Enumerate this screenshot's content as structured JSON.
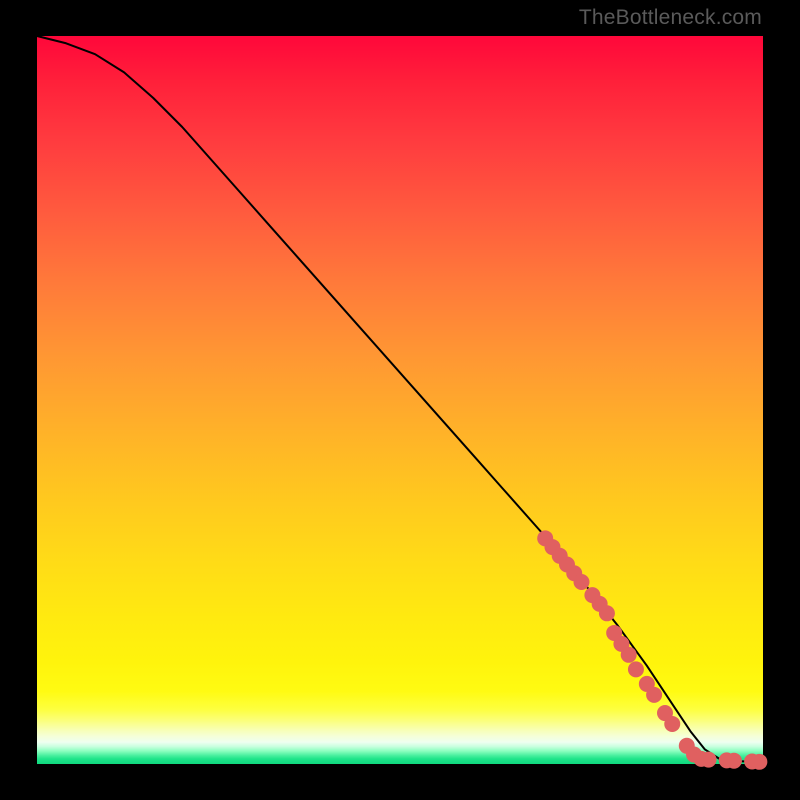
{
  "watermark": "TheBottleneck.com",
  "chart_data": {
    "type": "line",
    "title": "",
    "xlabel": "",
    "ylabel": "",
    "xlim": [
      0,
      100
    ],
    "ylim": [
      0,
      100
    ],
    "grid": false,
    "legend": false,
    "series": [
      {
        "name": "curve",
        "color": "#000000",
        "x": [
          0,
          4,
          8,
          12,
          16,
          20,
          24,
          28,
          32,
          36,
          40,
          44,
          48,
          52,
          56,
          60,
          64,
          68,
          72,
          76,
          80,
          84,
          86,
          88,
          90,
          92,
          94,
          96,
          98,
          100
        ],
        "y": [
          100,
          99,
          97.5,
          95,
          91.5,
          87.5,
          83,
          78.5,
          74,
          69.5,
          65,
          60.5,
          56,
          51.5,
          47,
          42.5,
          38,
          33.5,
          29,
          24,
          19,
          13.5,
          10.5,
          7.5,
          4.5,
          2.0,
          0.7,
          0.4,
          0.35,
          0.3
        ]
      }
    ],
    "markers": {
      "name": "highlighted-points",
      "color": "#e06060",
      "radius_pct": 1.1,
      "points": [
        {
          "x": 70.0,
          "y": 31.0
        },
        {
          "x": 71.0,
          "y": 29.8
        },
        {
          "x": 72.0,
          "y": 28.6
        },
        {
          "x": 73.0,
          "y": 27.4
        },
        {
          "x": 74.0,
          "y": 26.2
        },
        {
          "x": 75.0,
          "y": 25.0
        },
        {
          "x": 76.5,
          "y": 23.2
        },
        {
          "x": 77.5,
          "y": 22.0
        },
        {
          "x": 78.5,
          "y": 20.7
        },
        {
          "x": 79.5,
          "y": 18.0
        },
        {
          "x": 80.5,
          "y": 16.5
        },
        {
          "x": 81.5,
          "y": 15.0
        },
        {
          "x": 82.5,
          "y": 13.0
        },
        {
          "x": 84.0,
          "y": 11.0
        },
        {
          "x": 85.0,
          "y": 9.5
        },
        {
          "x": 86.5,
          "y": 7.0
        },
        {
          "x": 87.5,
          "y": 5.5
        },
        {
          "x": 89.5,
          "y": 2.5
        },
        {
          "x": 90.5,
          "y": 1.3
        },
        {
          "x": 91.5,
          "y": 0.7
        },
        {
          "x": 92.5,
          "y": 0.6
        },
        {
          "x": 95.0,
          "y": 0.5
        },
        {
          "x": 96.0,
          "y": 0.45
        },
        {
          "x": 98.5,
          "y": 0.35
        },
        {
          "x": 99.5,
          "y": 0.3
        }
      ]
    }
  }
}
